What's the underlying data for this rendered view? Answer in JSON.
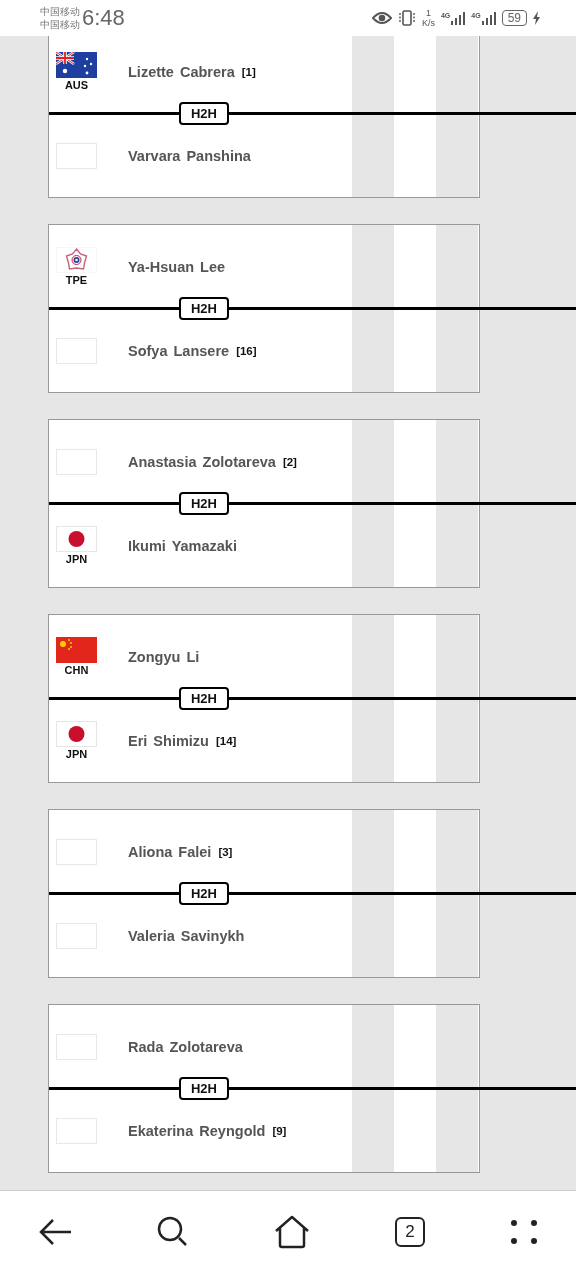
{
  "status_bar": {
    "carriers": [
      "中国移动",
      "中国移动"
    ],
    "time": "6:48",
    "speed_value": "1",
    "speed_unit": "K/s",
    "network_labels": [
      "4G",
      "4G"
    ],
    "battery": "59",
    "charging": true
  },
  "matches": [
    {
      "h2h": "H2H",
      "players": [
        {
          "flag": {
            "kind": "aus"
          },
          "country": "AUS",
          "name": "Lizette Cabrera",
          "seed": "[1]"
        },
        {
          "flag": {
            "kind": "none"
          },
          "name": "Varvara Panshina"
        }
      ]
    },
    {
      "h2h": "H2H",
      "players": [
        {
          "flag": {
            "kind": "tpe"
          },
          "country": "TPE",
          "name": "Ya-Hsuan Lee"
        },
        {
          "flag": {
            "kind": "none"
          },
          "name": "Sofya Lansere",
          "seed": "[16]"
        }
      ]
    },
    {
      "h2h": "H2H",
      "players": [
        {
          "flag": {
            "kind": "none"
          },
          "name": "Anastasia Zolotareva",
          "seed": "[2]"
        },
        {
          "flag": {
            "kind": "jpn"
          },
          "country": "JPN",
          "name": "Ikumi Yamazaki"
        }
      ]
    },
    {
      "h2h": "H2H",
      "players": [
        {
          "flag": {
            "kind": "chn"
          },
          "country": "CHN",
          "name": "Zongyu Li"
        },
        {
          "flag": {
            "kind": "jpn"
          },
          "country": "JPN",
          "name": "Eri Shimizu",
          "seed": "[14]"
        }
      ]
    },
    {
      "h2h": "H2H",
      "players": [
        {
          "flag": {
            "kind": "none"
          },
          "name": "Aliona Falei",
          "seed": "[3]"
        },
        {
          "flag": {
            "kind": "none"
          },
          "name": "Valeria Savinykh"
        }
      ]
    },
    {
      "h2h": "H2H",
      "players": [
        {
          "flag": {
            "kind": "none"
          },
          "name": "Rada Zolotareva"
        },
        {
          "flag": {
            "kind": "none"
          },
          "name": "Ekaterina Reyngold",
          "seed": "[9]"
        }
      ]
    }
  ],
  "nav": {
    "tab_count": "2"
  }
}
